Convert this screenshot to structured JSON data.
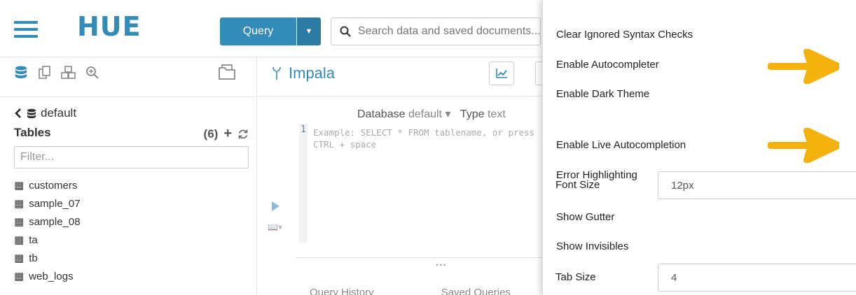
{
  "app": {
    "logo_text": "HUE",
    "query_button": "Query",
    "search_placeholder": "Search data and saved documents...",
    "colors": {
      "brand": "#338bb8",
      "arrow": "#f5b20f"
    }
  },
  "assist": {
    "database": "default",
    "tables_label": "Tables",
    "tables_count": "(6)",
    "filter_placeholder": "Filter...",
    "tables": [
      "customers",
      "sample_07",
      "sample_08",
      "ta",
      "tb",
      "web_logs"
    ]
  },
  "editor": {
    "title": "Impala",
    "database_label": "Database",
    "database_value": "default",
    "type_label": "Type",
    "type_value": "text",
    "line_number": "1",
    "placeholder_line1": "Example: SELECT * FROM tablename, or press",
    "placeholder_line2": "CTRL + space",
    "tabs": [
      "Query History",
      "Saved Queries"
    ]
  },
  "settings": {
    "clear_ignored": {
      "label": "Clear Ignored Syntax Checks",
      "checked": false
    },
    "autocompleter": {
      "label": "Enable Autocompleter",
      "checked": true
    },
    "dark_theme": {
      "label": "Enable Dark Theme",
      "checked": false
    },
    "live_autocompletion": {
      "label": "Enable Live Autocompletion",
      "checked": true
    },
    "error_highlighting": {
      "label": "Error Highlighting",
      "checked": true
    },
    "font_size": {
      "label": "Font Size",
      "value": "12px"
    },
    "show_gutter": {
      "label": "Show Gutter",
      "checked": true
    },
    "show_invisibles": {
      "label": "Show Invisibles",
      "checked": false
    },
    "tab_size": {
      "label": "Tab Size",
      "value": "4"
    }
  }
}
